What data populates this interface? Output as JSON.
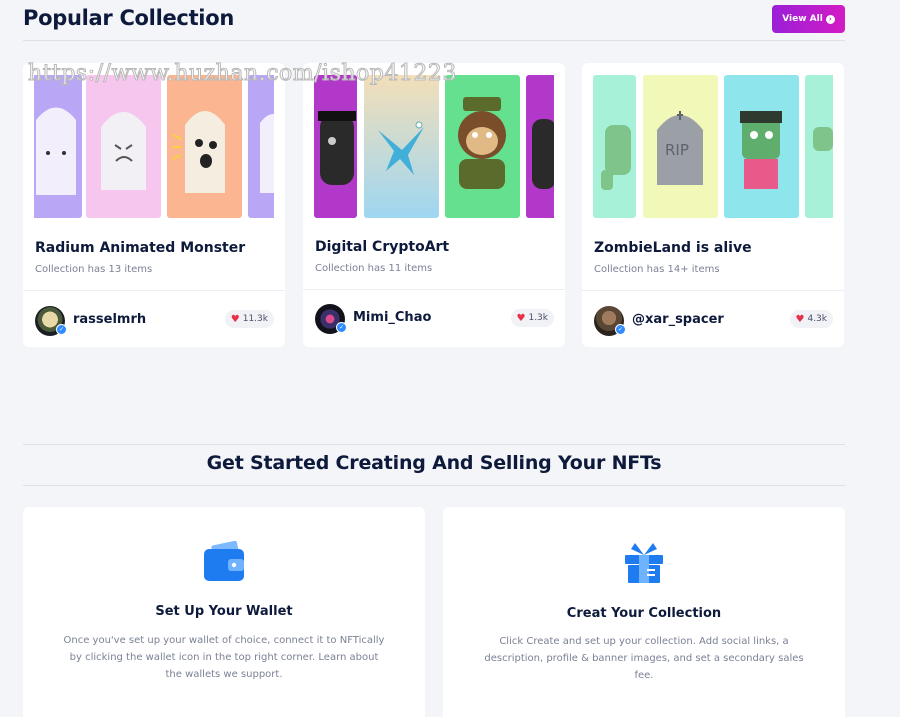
{
  "popular": {
    "title": "Popular Collection",
    "view_all_label": "View All",
    "collections": [
      {
        "name": "Radium Animated Monster",
        "subtitle": "Collection has 13 items",
        "owner": "rasselmrh",
        "likes": "11.3k"
      },
      {
        "name": "Digital CryptoArt",
        "subtitle": "Collection has 11 items",
        "owner": "Mimi_Chao",
        "likes": "1.3k"
      },
      {
        "name": "ZombieLand is alive",
        "subtitle": "Collection has 14+ items",
        "owner": "@xar_spacer",
        "likes": "4.3k"
      }
    ]
  },
  "watermark": "https://www.huzhan.com/ishop41223",
  "get_started": {
    "title": "Get Started Creating And Selling Your NFTs",
    "steps": [
      {
        "title": "Set Up Your Wallet",
        "description": "Once you've set up your wallet of choice, connect it to NFTically by clicking the wallet icon in the top right corner. Learn about the wallets we support."
      },
      {
        "title": "Creat Your Collection",
        "description": "Click Create and set up your collection. Add social links, a description, profile & banner images, and set a secondary sales fee."
      }
    ]
  },
  "colors": {
    "accent_start": "#9b1fd8",
    "accent_end": "#d21cc4",
    "heart": "#e8304a",
    "icon_blue": "#1e7bf0"
  },
  "icons": [
    "arrow-right-circle-icon",
    "heart-icon",
    "verified-icon",
    "wallet-icon",
    "gift-box-icon"
  ]
}
